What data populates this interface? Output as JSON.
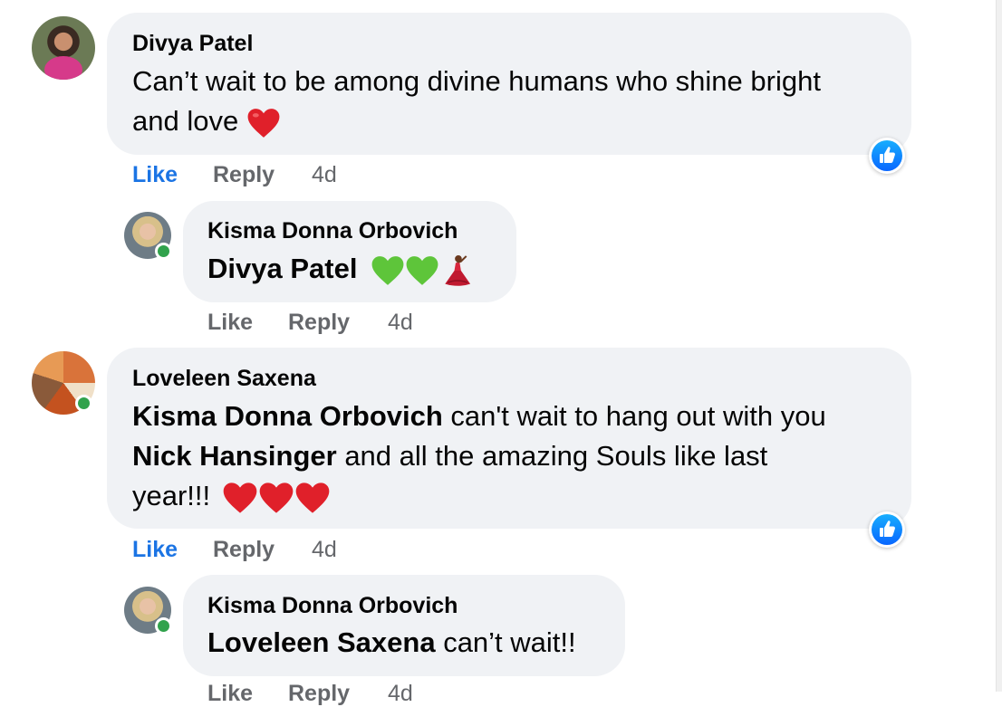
{
  "colors": {
    "like_blue": "#1b74e4",
    "action_grey": "#65676b",
    "bubble_bg": "#f0f2f5",
    "online_green": "#31a24c",
    "heart_red": "#e0202a",
    "heart_green": "#5ec53a"
  },
  "comments": [
    {
      "author": "Divya Patel",
      "line1": "Can’t wait to be among divine humans who shine bright",
      "line2": "and love",
      "reactions": [
        "red-heart-emoji"
      ],
      "like_badge": "thumbs-up-icon",
      "actions": {
        "like": "Like",
        "reply": "Reply",
        "time": "4d"
      },
      "replies": [
        {
          "author": "Kisma Donna Orbovich",
          "mention": "Divya Patel",
          "text": "",
          "reactions": [
            "green-heart-emoji",
            "green-heart-emoji",
            "dancer-emoji"
          ],
          "actions": {
            "like": "Like",
            "reply": "Reply",
            "time": "4d"
          }
        }
      ]
    },
    {
      "author": "Loveleen Saxena",
      "mention1": "Kisma Donna Orbovich",
      "line1": " can't wait to hang out with you",
      "mention2": "Nick Hansinger",
      "line2": " and all the amazing Souls like last",
      "line3": "year!!!",
      "reactions": [
        "red-heart-emoji",
        "red-heart-emoji",
        "red-heart-emoji"
      ],
      "like_badge": "thumbs-up-icon",
      "actions": {
        "like": "Like",
        "reply": "Reply",
        "time": "4d"
      },
      "replies": [
        {
          "author": "Kisma Donna Orbovich",
          "mention": "Loveleen Saxena",
          "text": " can’t wait!!",
          "actions": {
            "like": "Like",
            "reply": "Reply",
            "time": "4d"
          }
        }
      ]
    }
  ]
}
